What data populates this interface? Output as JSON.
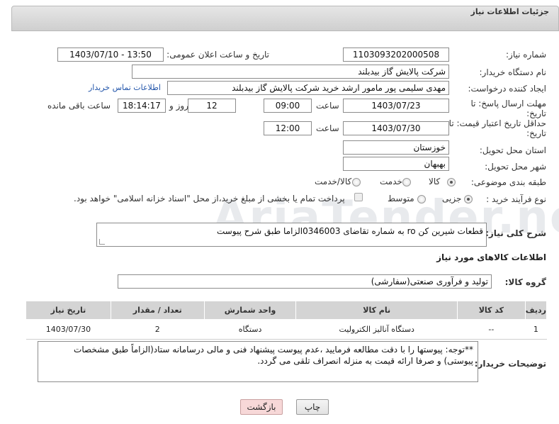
{
  "panel": {
    "title": "جزئیات اطلاعات نیاز"
  },
  "fields": {
    "need_number": {
      "label": "شماره نیاز:",
      "value": "1103093202000508"
    },
    "announce_datetime": {
      "label": "تاریخ و ساعت اعلان عمومی:",
      "value": "1403/07/10 - 13:50"
    },
    "buyer_org": {
      "label": "نام دستگاه خریدار:",
      "value": "شرکت پالایش گاز بیدبلند"
    },
    "requester": {
      "label": "ایجاد کننده درخواست:",
      "value": "مهدی سلیمی پور مامور ارشد خرید شرکت پالایش گاز بیدبلند",
      "contact_link": "اطلاعات تماس خریدار"
    },
    "response_deadline": {
      "label_line1": "مهلت ارسال پاسخ: تا",
      "label_line2": "تاریخ:",
      "date": "1403/07/23",
      "time_label": "ساعت",
      "time": "09:00",
      "days": "12",
      "days_label": "روز و",
      "remaining": "18:14:17",
      "remaining_label": "ساعت باقی مانده"
    },
    "price_validity": {
      "label_line1": "حداقل تاریخ اعتبار قیمت: تا",
      "label_line2": "تاریخ:",
      "date": "1403/07/30",
      "time_label": "ساعت",
      "time": "12:00"
    },
    "delivery_province": {
      "label": "استان محل تحویل:",
      "value": "خوزستان"
    },
    "delivery_city": {
      "label": "شهر محل تحویل:",
      "value": "بهبهان"
    },
    "category": {
      "label": "طبقه بندی موضوعی:",
      "options": [
        "کالا",
        "خدمت",
        "کالا/خدمت"
      ],
      "selected": "کالا"
    },
    "process_type": {
      "label": "نوع فرآیند خرید :",
      "options": [
        "جزیی",
        "متوسط"
      ],
      "selected": "جزیی",
      "payment_note": "پرداخت تمام یا بخشی از مبلغ خرید،از محل \"اسناد خزانه اسلامی\" خواهد بود."
    }
  },
  "description": {
    "label": "شرح کلی نیاز:",
    "value": "قطعات شیرین کن ro  به شماره تقاضای 0346003الزاما طبق شرح پیوست"
  },
  "goods_section": {
    "title": "اطلاعات کالاهای مورد نیاز",
    "group_label": "گروه کالا:",
    "group_value": "تولید و فرآوری صنعتی(سفارشی)",
    "columns": [
      "ردیف",
      "کد کالا",
      "نام کالا",
      "واحد شمارش",
      "تعداد / مقدار",
      "تاریخ نیاز"
    ],
    "rows": [
      {
        "index": "1",
        "code": "--",
        "name": "دستگاه آنالیز الکترولیت",
        "unit": "دستگاه",
        "qty": "2",
        "date": "1403/07/30"
      }
    ]
  },
  "buyer_notes": {
    "label": "توضیحات خریدار:",
    "value": "**توجه: پیوستها را با دقت مطالعه فرمایید ،عدم پیوست پیشنهاد فنی و مالی درسامانه ستاد(الزاماً طبق مشخصات پیوستی) و صرفا ارائه قیمت به منزله انصراف تلقی می گردد."
  },
  "buttons": {
    "print": "چاپ",
    "back": "بازگشت"
  },
  "watermark": {
    "text": "AriaTender.net"
  },
  "colors": {
    "header_bg": "#d9d9d9",
    "table_header": "#d4d4d4",
    "back_button": "#f7d8d8",
    "link": "#2255aa"
  }
}
